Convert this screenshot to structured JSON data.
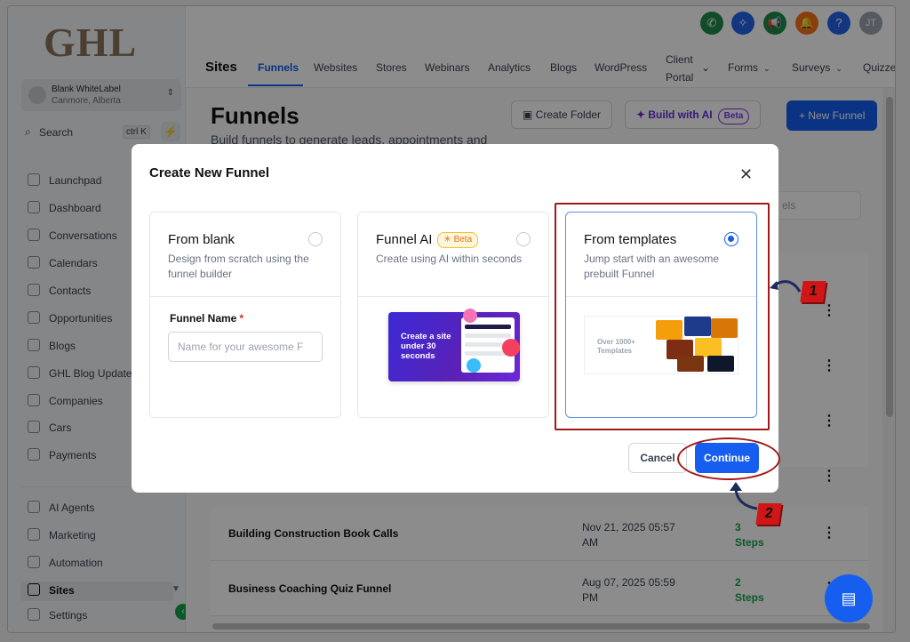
{
  "brand": {
    "logo_text": "GHL"
  },
  "account": {
    "name": "Blank WhiteLabel",
    "location": "Canmore, Alberta"
  },
  "search": {
    "label": "Search",
    "shortcut": "ctrl K"
  },
  "sidebar": {
    "items": [
      {
        "label": "Launchpad",
        "icon": "rocket-icon"
      },
      {
        "label": "Dashboard",
        "icon": "grid-icon"
      },
      {
        "label": "Conversations",
        "icon": "chat-icon"
      },
      {
        "label": "Calendars",
        "icon": "calendar-icon"
      },
      {
        "label": "Contacts",
        "icon": "contacts-icon"
      },
      {
        "label": "Opportunities",
        "icon": "pipeline-icon"
      },
      {
        "label": "Blogs",
        "icon": "blog-icon"
      },
      {
        "label": "GHL Blog Update",
        "icon": "doc-icon"
      },
      {
        "label": "Companies",
        "icon": "building-icon"
      },
      {
        "label": "Cars",
        "icon": "car-icon"
      },
      {
        "label": "Payments",
        "icon": "receipt-icon"
      }
    ],
    "bottom_items": [
      {
        "label": "AI Agents",
        "icon": "sparkle-icon"
      },
      {
        "label": "Marketing",
        "icon": "send-icon"
      },
      {
        "label": "Automation",
        "icon": "play-icon"
      },
      {
        "label": "Sites",
        "icon": "site-icon",
        "active": true
      },
      {
        "label": "Settings",
        "icon": "gear-icon"
      }
    ]
  },
  "topnav": {
    "section": "Sites",
    "tabs": [
      "Funnels",
      "Websites",
      "Stores",
      "Webinars",
      "Analytics",
      "Blogs",
      "WordPress",
      "Client",
      "Portal",
      "Forms",
      "Surveys",
      "Quizzes"
    ]
  },
  "header_icons": {
    "colors": [
      "#1f8a4c",
      "#2563eb",
      "#1f8a4c",
      "#f97316",
      "#2563eb",
      "#9ca3af"
    ],
    "avatar_initials": "JT",
    "help": "?"
  },
  "page": {
    "title": "Funnels",
    "subtitle": "Build funnels to generate leads, appointments and",
    "create_folder": "Create Folder",
    "build_ai": "Build with AI",
    "beta": "Beta",
    "new_funnel": "New Funnel",
    "search_fragment": "els"
  },
  "rows": [
    {
      "name": "Building Construction Book Calls",
      "date1": "Nov 21, 2025 05:57",
      "date2": "AM",
      "steps1": "3",
      "steps2": "Steps"
    },
    {
      "name": "Business Coaching Quiz Funnel",
      "date1": "Aug 07, 2025 05:59",
      "date2": "PM",
      "steps1": "2",
      "steps2": "Steps"
    }
  ],
  "modal": {
    "title": "Create New Funnel",
    "close": "✕",
    "blank": {
      "title": "From blank",
      "desc": "Design from scratch using the funnel builder",
      "field_label": "Funnel Name",
      "required": "*",
      "placeholder": "Name for your awesome F"
    },
    "ai": {
      "title": "Funnel AI",
      "beta": "Beta",
      "desc": "Create using AI within seconds",
      "preview_text": "Create a site under 30 seconds"
    },
    "templates": {
      "title": "From templates",
      "desc": "Jump start with an awesome prebuilt Funnel",
      "preview_text": "Over 1000+ Templates",
      "selected": true
    },
    "cancel": "Cancel",
    "continue": "Continue"
  },
  "annotations": {
    "badge1": "1",
    "badge2": "2",
    "color": "#a01818"
  }
}
